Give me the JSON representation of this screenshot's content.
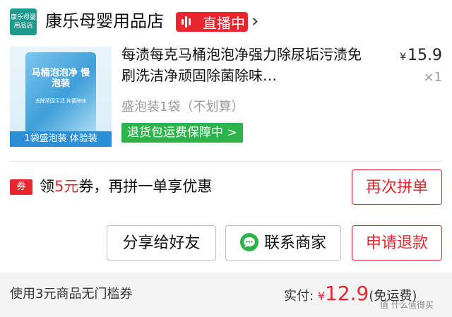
{
  "shop": {
    "logo_line1": "康乐母婴",
    "logo_line2": "用品店",
    "name": "康乐母婴用品店",
    "live_label": "直播中",
    "chevron": "›"
  },
  "product": {
    "image_pack_title": "马桶泡泡净 慢泡装",
    "image_pack_sub": "去除顽固污渍 抑菌除味",
    "image_banner": "1袋盛泡装 体验装",
    "title": "每渍每克马桶泡泡净强力除尿垢污渍免刷洗洁净顽固除菌除味…",
    "price_currency": "¥",
    "price_value": "15.9",
    "quantity": "×1",
    "variant": "盛泡装1袋（不划算）",
    "return_badge": "退货包运费保障中 >"
  },
  "coupon": {
    "tag": "券",
    "text_prefix": "领",
    "amount": "5元",
    "text_suffix": "券，再拼一单享优惠",
    "rebuy_button": "再次拼单"
  },
  "actions": {
    "share_button": "分享给好友",
    "contact_button": "联系商家",
    "refund_button": "申请退款"
  },
  "footer": {
    "coupon_note": "使用3元商品无门槛券",
    "paid_label": "实付:",
    "paid_currency": "¥",
    "paid_amount": "12.9",
    "shipping_note": "(免运费)",
    "watermark": "值 什么值得买"
  },
  "colors": {
    "accent_red": "#e8262d",
    "badge_green": "#2cb34a",
    "shop_logo": "#1c9a8c"
  }
}
